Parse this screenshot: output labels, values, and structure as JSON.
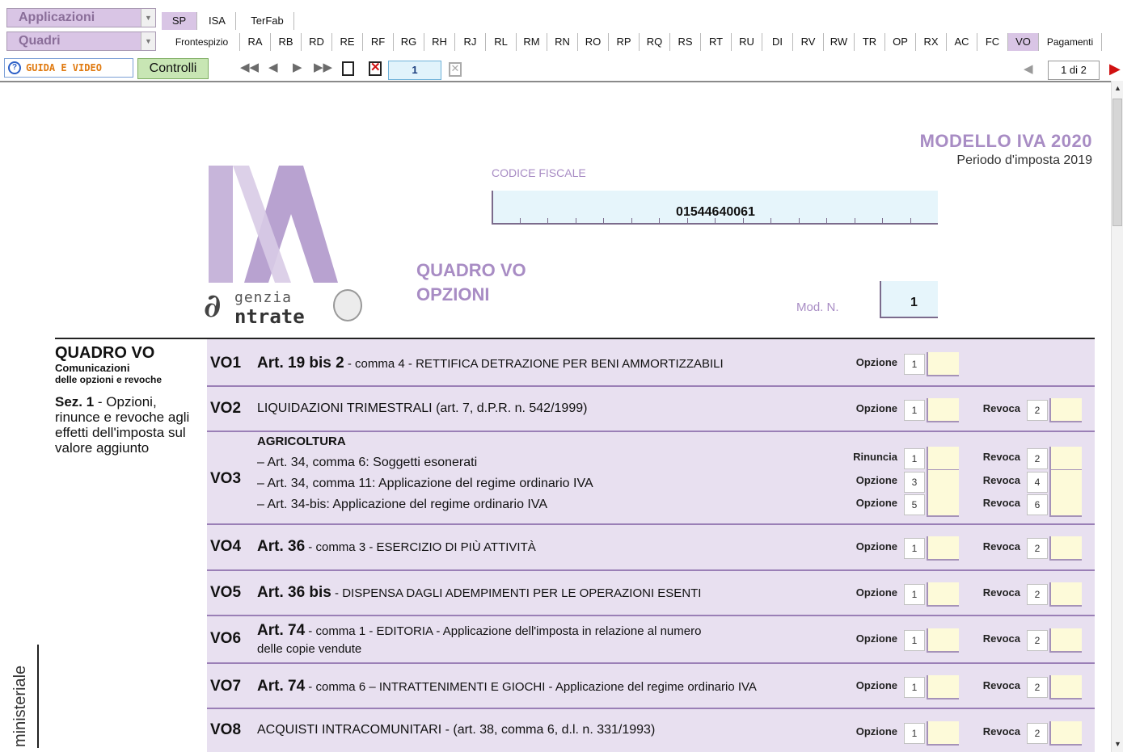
{
  "toolbar": {
    "applicazioni_label": "Applicazioni",
    "quadri_label": "Quadri",
    "top_tabs": [
      "SP",
      "ISA",
      "TerFab"
    ],
    "quadri_tabs": [
      "Frontespizio",
      "RA",
      "RB",
      "RD",
      "RE",
      "RF",
      "RG",
      "RH",
      "RJ",
      "RL",
      "RM",
      "RN",
      "RO",
      "RP",
      "RQ",
      "RS",
      "RT",
      "RU",
      "DI",
      "RV",
      "RW",
      "TR",
      "OP",
      "RX",
      "AC",
      "FC",
      "VO",
      "Pagamenti"
    ],
    "active_top_tab": "SP",
    "active_quadri_tab": "VO",
    "guida_label": "GUIDA E VIDEO",
    "controlli_label": "Controlli",
    "record_number": "1",
    "page_indicator": "1 di 2"
  },
  "header": {
    "modello_title": "MODELLO IVA 2020",
    "periodo": "Periodo d'imposta 2019",
    "codice_fiscale_label": "CODICE FISCALE",
    "codice_fiscale_value": "01544640061",
    "logo_agenzia": "genzia",
    "logo_entrate": "ntrate",
    "quadro_title_1": "QUADRO VO",
    "quadro_title_2": "OPZIONI",
    "mod_n_label": "Mod. N.",
    "mod_n_value": "1"
  },
  "left": {
    "title": "QUADRO VO",
    "subtitle_1": "Comunicazioni",
    "subtitle_2": "delle opzioni e revoche",
    "sez_bold": "Sez. 1",
    "sez_text": " - Opzioni, rinunce e revoche agli effetti dell'imposta sul valore aggiunto",
    "side_label": "ministeriale"
  },
  "rows": [
    {
      "code": "VO1",
      "art": "Art. 19 bis 2",
      "text": " - comma 4 - RETTIFICA DETRAZIONE PER BENI AMMORTIZZABILI"
    },
    {
      "code": "VO2",
      "art": "",
      "text": "LIQUIDAZIONI TRIMESTRALI (art. 7, d.P.R. n. 542/1999)"
    },
    {
      "code": "VO3",
      "heading": "AGRICOLTURA",
      "lines": [
        "– Art. 34, comma 6: Soggetti esonerati",
        "– Art. 34, comma 11: Applicazione del regime ordinario IVA",
        "– Art. 34-bis: Applicazione del regime ordinario IVA"
      ]
    },
    {
      "code": "VO4",
      "art": "Art. 36",
      "text": " - comma 3 - ESERCIZIO DI PIÙ ATTIVITÀ"
    },
    {
      "code": "VO5",
      "art": "Art. 36 bis",
      "text": " - DISPENSA DAGLI ADEMPIMENTI PER LE OPERAZIONI ESENTI"
    },
    {
      "code": "VO6",
      "art": "Art. 74",
      "text": " - comma 1 - EDITORIA - Applicazione dell'imposta in relazione al numero",
      "text2": "delle copie vendute"
    },
    {
      "code": "VO7",
      "art": "Art. 74",
      "text": " - comma 6 – INTRATTENIMENTI E GIOCHI - Applicazione del regime ordinario IVA"
    },
    {
      "code": "VO8",
      "art": "",
      "text": "ACQUISTI INTRACOMUNITARI - (art. 38, comma 6, d.l. n. 331/1993)"
    }
  ],
  "labels": {
    "opzione": "Opzione",
    "revoca": "Revoca",
    "rinuncia": "Rinuncia"
  },
  "numbers": [
    "1",
    "2",
    "3",
    "4",
    "5",
    "6"
  ]
}
